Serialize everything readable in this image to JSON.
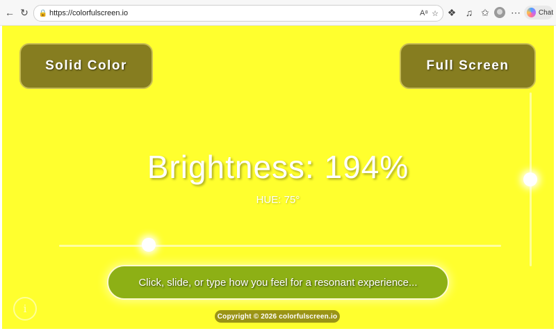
{
  "browser": {
    "url": "https://colorfulscreen.io",
    "chat_label": "Chat",
    "icons": [
      "back-icon",
      "reload-icon",
      "lock-icon",
      "read-aloud-icon",
      "favorite-icon",
      "extensions-icon",
      "media-icon",
      "collections-icon",
      "profile-icon",
      "more-icon",
      "copilot-icon"
    ]
  },
  "page": {
    "solid_label": "Solid Color",
    "full_label": "Full Screen",
    "brightness_text": "Brightness: 194%",
    "hue_text": "HUE: 75°",
    "brightness_value": 194,
    "hue_value": 75,
    "input_placeholder": "Click, slide, or type how you feel for a resonant experience...",
    "info_symbol": "i",
    "copyright": "Copyright © 2026 colorfulscreen.io"
  },
  "colors": {
    "background": "#ffff2e",
    "button": "#867d20",
    "input": "#8db015"
  }
}
